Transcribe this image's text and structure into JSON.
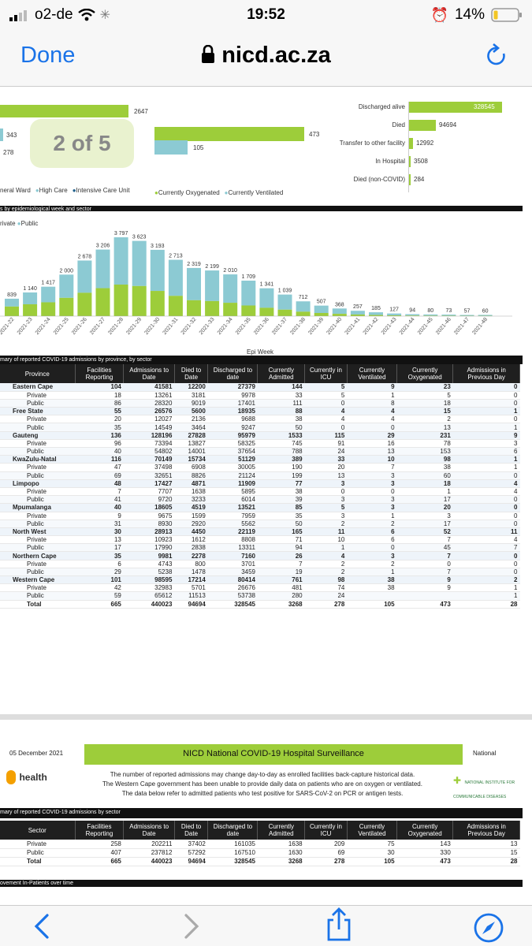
{
  "status": {
    "carrier": "o2-de",
    "time": "19:52",
    "battery": "14%"
  },
  "nav": {
    "done": "Done",
    "url": "nicd.ac.za"
  },
  "badge": "2 of 5",
  "top_left_values": [
    "2647",
    "343",
    "278"
  ],
  "ward_legend": [
    "neral Ward",
    "High Care",
    "Intensive Care Unit"
  ],
  "oxy_values": [
    "473",
    "105"
  ],
  "oxy_legend": [
    "Currently Oxygenated",
    "Currently Ventilated"
  ],
  "outcomes": [
    {
      "label": "Discharged alive",
      "value": "328545"
    },
    {
      "label": "Died",
      "value": "94694"
    },
    {
      "label": "Transfer to other facility",
      "value": "12992"
    },
    {
      "label": "In Hospital",
      "value": "3508"
    },
    {
      "label": "Died (non-COVID)",
      "value": "284"
    }
  ],
  "weekly_caption": "s by epidemiological week and sector",
  "weekly_legend": [
    "rivate",
    "Public"
  ],
  "chart_data": {
    "type": "bar",
    "xlabel": "Epi Week",
    "categories": [
      "2021-22",
      "2021-23",
      "2021-24",
      "2021-25",
      "2021-26",
      "2021-27",
      "2021-28",
      "2021-29",
      "2021-30",
      "2021-31",
      "2021-32",
      "2021-33",
      "2021-34",
      "2021-35",
      "2021-36",
      "2021-37",
      "2021-38",
      "2021-39",
      "2021-40",
      "2021-41",
      "2021-42",
      "2021-43",
      "2021-44",
      "2021-45",
      "2021-46",
      "2021-47",
      "2021-48"
    ],
    "totals": [
      839,
      1140,
      1417,
      2000,
      2678,
      3206,
      3797,
      3623,
      3193,
      2713,
      2319,
      2199,
      2010,
      1709,
      1341,
      1039,
      712,
      507,
      368,
      257,
      185,
      127,
      94,
      80,
      73,
      57,
      60
    ],
    "total_labels": [
      "839",
      "1 140",
      "1 417",
      "2 000",
      "2 678",
      "3 206",
      "3 797",
      "3 623",
      "3 193",
      "2 713",
      "2 319",
      "2 199",
      "2 010",
      "1 709",
      "1 341",
      "1 039",
      "712",
      "507",
      "368",
      "257",
      "185",
      "127",
      "94",
      "80",
      "73",
      "57",
      "60"
    ],
    "private_share": [
      0.55,
      0.5,
      0.47,
      0.44,
      0.42,
      0.42,
      0.4,
      0.4,
      0.38,
      0.36,
      0.33,
      0.33,
      0.32,
      0.3,
      0.3,
      0.3,
      0.3,
      0.3,
      0.3,
      0.3,
      0.3,
      0.3,
      0.3,
      0.3,
      0.3,
      0.3,
      0.3
    ],
    "colors": {
      "private": "#9dcd3a",
      "public": "#8ccad3"
    }
  },
  "prov_caption": "mary of reported COVID-19 admissions by province, by sector",
  "prov_headers": [
    "Province",
    "Facilities Reporting",
    "Admissions to Date",
    "Died to Date",
    "Discharged to date",
    "Currently Admitted",
    "Currently in ICU",
    "Currently Ventilated",
    "Currently Oxygenated",
    "Admissions in Previous Day"
  ],
  "prov_rows": [
    {
      "t": "sec",
      "c": [
        "Eastern Cape",
        "104",
        "41581",
        "12200",
        "27379",
        "144",
        "5",
        "9",
        "23",
        "0"
      ]
    },
    {
      "t": "",
      "c": [
        "Private",
        "18",
        "13261",
        "3181",
        "9978",
        "33",
        "5",
        "1",
        "5",
        "0"
      ]
    },
    {
      "t": "alt",
      "c": [
        "Public",
        "86",
        "28320",
        "9019",
        "17401",
        "111",
        "0",
        "8",
        "18",
        "0"
      ]
    },
    {
      "t": "sec",
      "c": [
        "Free State",
        "55",
        "26576",
        "5600",
        "18935",
        "88",
        "4",
        "4",
        "15",
        "1"
      ]
    },
    {
      "t": "",
      "c": [
        "Private",
        "20",
        "12027",
        "2136",
        "9688",
        "38",
        "4",
        "4",
        "2",
        "0"
      ]
    },
    {
      "t": "alt",
      "c": [
        "Public",
        "35",
        "14549",
        "3464",
        "9247",
        "50",
        "0",
        "0",
        "13",
        "1"
      ]
    },
    {
      "t": "sec",
      "c": [
        "Gauteng",
        "136",
        "128196",
        "27828",
        "95979",
        "1533",
        "115",
        "29",
        "231",
        "9"
      ]
    },
    {
      "t": "",
      "c": [
        "Private",
        "96",
        "73394",
        "13827",
        "58325",
        "745",
        "91",
        "16",
        "78",
        "3"
      ]
    },
    {
      "t": "alt",
      "c": [
        "Public",
        "40",
        "54802",
        "14001",
        "37654",
        "788",
        "24",
        "13",
        "153",
        "6"
      ]
    },
    {
      "t": "sec",
      "c": [
        "KwaZulu-Natal",
        "116",
        "70149",
        "15734",
        "51129",
        "389",
        "33",
        "10",
        "98",
        "1"
      ]
    },
    {
      "t": "",
      "c": [
        "Private",
        "47",
        "37498",
        "6908",
        "30005",
        "190",
        "20",
        "7",
        "38",
        "1"
      ]
    },
    {
      "t": "alt",
      "c": [
        "Public",
        "69",
        "32651",
        "8826",
        "21124",
        "199",
        "13",
        "3",
        "60",
        "0"
      ]
    },
    {
      "t": "sec",
      "c": [
        "Limpopo",
        "48",
        "17427",
        "4871",
        "11909",
        "77",
        "3",
        "3",
        "18",
        "4"
      ]
    },
    {
      "t": "",
      "c": [
        "Private",
        "7",
        "7707",
        "1638",
        "5895",
        "38",
        "0",
        "0",
        "1",
        "4"
      ]
    },
    {
      "t": "alt",
      "c": [
        "Public",
        "41",
        "9720",
        "3233",
        "6014",
        "39",
        "3",
        "3",
        "17",
        "0"
      ]
    },
    {
      "t": "sec",
      "c": [
        "Mpumalanga",
        "40",
        "18605",
        "4519",
        "13521",
        "85",
        "5",
        "3",
        "20",
        "0"
      ]
    },
    {
      "t": "",
      "c": [
        "Private",
        "9",
        "9675",
        "1599",
        "7959",
        "35",
        "3",
        "1",
        "3",
        "0"
      ]
    },
    {
      "t": "alt",
      "c": [
        "Public",
        "31",
        "8930",
        "2920",
        "5562",
        "50",
        "2",
        "2",
        "17",
        "0"
      ]
    },
    {
      "t": "sec",
      "c": [
        "North West",
        "30",
        "28913",
        "4450",
        "22119",
        "165",
        "11",
        "6",
        "52",
        "11"
      ]
    },
    {
      "t": "",
      "c": [
        "Private",
        "13",
        "10923",
        "1612",
        "8808",
        "71",
        "10",
        "6",
        "7",
        "4"
      ]
    },
    {
      "t": "alt",
      "c": [
        "Public",
        "17",
        "17990",
        "2838",
        "13311",
        "94",
        "1",
        "0",
        "45",
        "7"
      ]
    },
    {
      "t": "sec",
      "c": [
        "Northern Cape",
        "35",
        "9981",
        "2278",
        "7160",
        "26",
        "4",
        "3",
        "7",
        "0"
      ]
    },
    {
      "t": "",
      "c": [
        "Private",
        "6",
        "4743",
        "800",
        "3701",
        "7",
        "2",
        "2",
        "0",
        "0"
      ]
    },
    {
      "t": "alt",
      "c": [
        "Public",
        "29",
        "5238",
        "1478",
        "3459",
        "19",
        "2",
        "1",
        "7",
        "0"
      ]
    },
    {
      "t": "sec",
      "c": [
        "Western Cape",
        "101",
        "98595",
        "17214",
        "80414",
        "761",
        "98",
        "38",
        "9",
        "2"
      ]
    },
    {
      "t": "",
      "c": [
        "Private",
        "42",
        "32983",
        "5701",
        "26676",
        "481",
        "74",
        "38",
        "9",
        "1"
      ]
    },
    {
      "t": "alt",
      "c": [
        "Public",
        "59",
        "65612",
        "11513",
        "53738",
        "280",
        "24",
        "",
        "",
        "1"
      ]
    },
    {
      "t": "total",
      "c": [
        "Total",
        "665",
        "440023",
        "94694",
        "328545",
        "3268",
        "278",
        "105",
        "473",
        "28"
      ]
    }
  ],
  "report": {
    "date": "05 December 2021",
    "title": "NICD National COVID-19 Hospital Surveillance",
    "scope": "National",
    "note1": "The number of reported admissions may change day-to-day as enrolled facilities back-capture historical data.",
    "note2": "The Western Cape government has been unable to provide daily data on patients who are on oxygen or ventilated.",
    "note3": "The data below refer to admitted patients who test positive for SARS-CoV-2 on PCR or antigen tests.",
    "logo_left": "health",
    "logo_right": "NATIONAL INSTITUTE FOR COMMUNICABLE DISEASES"
  },
  "sector_caption": "mary of reported COVID-19 admissions by sector",
  "sector_headers": [
    "Sector",
    "Facilities Reporting",
    "Admissions to Date",
    "Died to Date",
    "Discharged to date",
    "Currently Admitted",
    "Currently in ICU",
    "Currently Ventilated",
    "Currently Oxygenated",
    "Admissions in Previous Day"
  ],
  "sector_rows": [
    {
      "t": "",
      "c": [
        "Private",
        "258",
        "202211",
        "37402",
        "161035",
        "1638",
        "209",
        "75",
        "143",
        "13"
      ]
    },
    {
      "t": "",
      "c": [
        "Public",
        "407",
        "237812",
        "57292",
        "167510",
        "1630",
        "69",
        "30",
        "330",
        "15"
      ]
    },
    {
      "t": "total",
      "c": [
        "Total",
        "665",
        "440023",
        "94694",
        "328545",
        "3268",
        "278",
        "105",
        "473",
        "28"
      ]
    }
  ],
  "bottom_caption": "ovement In-Patients over time",
  "toolbar": {
    "back": "back-icon",
    "forward": "forward-icon",
    "share": "share-icon",
    "compass": "compass-icon"
  }
}
